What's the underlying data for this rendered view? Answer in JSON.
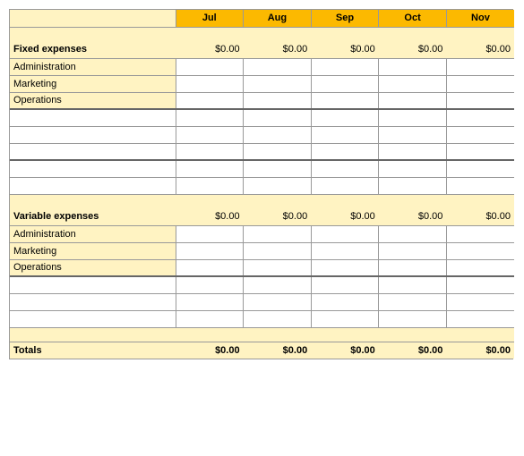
{
  "months": [
    "Jul",
    "Aug",
    "Sep",
    "Oct",
    "Nov"
  ],
  "sections": [
    {
      "label": "Fixed expenses",
      "values": [
        "$0.00",
        "$0.00",
        "$0.00",
        "$0.00",
        "$0.00"
      ],
      "categories": [
        "Administration",
        "Marketing",
        "Operations"
      ]
    },
    {
      "label": "Variable expenses",
      "values": [
        "$0.00",
        "$0.00",
        "$0.00",
        "$0.00",
        "$0.00"
      ],
      "categories": [
        "Administration",
        "Marketing",
        "Operations"
      ]
    }
  ],
  "totals": {
    "label": "Totals",
    "values": [
      "$0.00",
      "$0.00",
      "$0.00",
      "$0.00",
      "$0.00"
    ]
  }
}
